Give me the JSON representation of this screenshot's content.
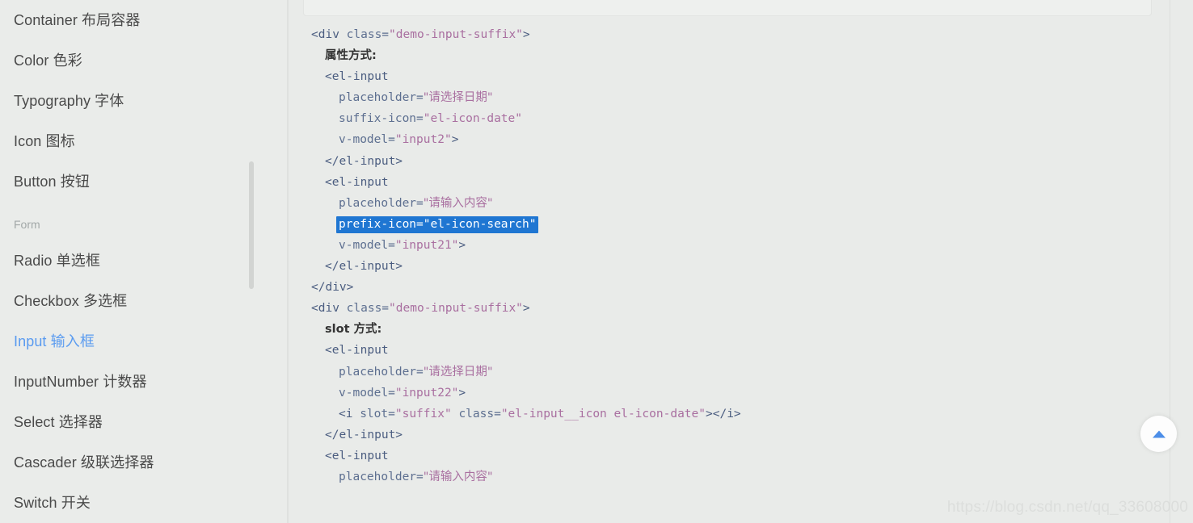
{
  "page": {
    "background_color": "#e9ebe9",
    "watermark": "https://blog.csdn.net/qq_33608000"
  },
  "sidebar": {
    "items": [
      {
        "label": "Container 布局容器",
        "type": "link",
        "active": false
      },
      {
        "label": "Color 色彩",
        "type": "link",
        "active": false
      },
      {
        "label": "Typography 字体",
        "type": "link",
        "active": false
      },
      {
        "label": "Icon 图标",
        "type": "link",
        "active": false
      },
      {
        "label": "Button 按钮",
        "type": "link",
        "active": false
      },
      {
        "label": "Form",
        "type": "group",
        "active": false
      },
      {
        "label": "Radio 单选框",
        "type": "link",
        "active": false
      },
      {
        "label": "Checkbox 多选框",
        "type": "link",
        "active": false
      },
      {
        "label": "Input 输入框",
        "type": "link",
        "active": true
      },
      {
        "label": "InputNumber 计数器",
        "type": "link",
        "active": false
      },
      {
        "label": "Select 选择器",
        "type": "link",
        "active": false
      },
      {
        "label": "Cascader 级联选择器",
        "type": "link",
        "active": false
      },
      {
        "label": "Switch 开关",
        "type": "link",
        "active": false
      }
    ],
    "active_color": "#5a9bf0",
    "text_color": "#4a4a4a",
    "group_color": "#a2a8a8"
  },
  "code": {
    "selection_color": "#1f76d2",
    "selection_text_color": "#ffffff",
    "selected_text": "prefix-icon=\"el-icon-search\"",
    "lines": [
      {
        "indent": 0,
        "selected": false,
        "tokens": [
          {
            "t": "tag",
            "v": "<div "
          },
          {
            "t": "attr",
            "v": "class="
          },
          {
            "t": "str",
            "v": "\"demo-input-suffix\""
          },
          {
            "t": "tag",
            "v": ">"
          }
        ]
      },
      {
        "indent": 1,
        "selected": false,
        "tokens": [
          {
            "t": "cn",
            "v": "属性方式:"
          }
        ]
      },
      {
        "indent": 1,
        "selected": false,
        "tokens": [
          {
            "t": "tag",
            "v": "<el-input"
          }
        ]
      },
      {
        "indent": 2,
        "selected": false,
        "tokens": [
          {
            "t": "attr",
            "v": "placeholder="
          },
          {
            "t": "cnstr",
            "v": "\"请选择日期\""
          }
        ]
      },
      {
        "indent": 2,
        "selected": false,
        "tokens": [
          {
            "t": "attr",
            "v": "suffix-icon="
          },
          {
            "t": "str",
            "v": "\"el-icon-date\""
          }
        ]
      },
      {
        "indent": 2,
        "selected": false,
        "tokens": [
          {
            "t": "attr",
            "v": "v-model="
          },
          {
            "t": "str",
            "v": "\"input2\""
          },
          {
            "t": "tag",
            "v": ">"
          }
        ]
      },
      {
        "indent": 1,
        "selected": false,
        "tokens": [
          {
            "t": "tag",
            "v": "</el-input>"
          }
        ]
      },
      {
        "indent": 1,
        "selected": false,
        "tokens": [
          {
            "t": "tag",
            "v": "<el-input"
          }
        ]
      },
      {
        "indent": 2,
        "selected": false,
        "tokens": [
          {
            "t": "attr",
            "v": "placeholder="
          },
          {
            "t": "cnstr",
            "v": "\"请输入内容\""
          }
        ]
      },
      {
        "indent": 2,
        "selected": true,
        "tokens": [
          {
            "t": "attr",
            "v": "prefix-icon="
          },
          {
            "t": "str",
            "v": "\"el-icon-search\""
          }
        ]
      },
      {
        "indent": 2,
        "selected": false,
        "tokens": [
          {
            "t": "attr",
            "v": "v-model="
          },
          {
            "t": "str",
            "v": "\"input21\""
          },
          {
            "t": "tag",
            "v": ">"
          }
        ]
      },
      {
        "indent": 1,
        "selected": false,
        "tokens": [
          {
            "t": "tag",
            "v": "</el-input>"
          }
        ]
      },
      {
        "indent": 0,
        "selected": false,
        "tokens": [
          {
            "t": "tag",
            "v": "</div>"
          }
        ]
      },
      {
        "indent": 0,
        "selected": false,
        "tokens": [
          {
            "t": "tag",
            "v": "<div "
          },
          {
            "t": "attr",
            "v": "class="
          },
          {
            "t": "str",
            "v": "\"demo-input-suffix\""
          },
          {
            "t": "tag",
            "v": ">"
          }
        ]
      },
      {
        "indent": 1,
        "selected": false,
        "tokens": [
          {
            "t": "cn",
            "v": "slot 方式:"
          }
        ]
      },
      {
        "indent": 1,
        "selected": false,
        "tokens": [
          {
            "t": "tag",
            "v": "<el-input"
          }
        ]
      },
      {
        "indent": 2,
        "selected": false,
        "tokens": [
          {
            "t": "attr",
            "v": "placeholder="
          },
          {
            "t": "cnstr",
            "v": "\"请选择日期\""
          }
        ]
      },
      {
        "indent": 2,
        "selected": false,
        "tokens": [
          {
            "t": "attr",
            "v": "v-model="
          },
          {
            "t": "str",
            "v": "\"input22\""
          },
          {
            "t": "tag",
            "v": ">"
          }
        ]
      },
      {
        "indent": 2,
        "selected": false,
        "tokens": [
          {
            "t": "tag",
            "v": "<i "
          },
          {
            "t": "attr",
            "v": "slot="
          },
          {
            "t": "str",
            "v": "\"suffix\""
          },
          {
            "t": "plain",
            "v": " "
          },
          {
            "t": "attr",
            "v": "class="
          },
          {
            "t": "str",
            "v": "\"el-input__icon el-icon-date\""
          },
          {
            "t": "tag",
            "v": "></i>"
          }
        ]
      },
      {
        "indent": 1,
        "selected": false,
        "tokens": [
          {
            "t": "tag",
            "v": "</el-input>"
          }
        ]
      },
      {
        "indent": 1,
        "selected": false,
        "tokens": [
          {
            "t": "tag",
            "v": "<el-input"
          }
        ]
      },
      {
        "indent": 2,
        "selected": false,
        "tokens": [
          {
            "t": "attr",
            "v": "placeholder="
          },
          {
            "t": "cnstr",
            "v": "\"请输入内容\""
          }
        ]
      }
    ]
  },
  "controls": {
    "back_to_top_icon": "triangle-up-icon",
    "back_to_top_color": "#4d8ee8"
  }
}
